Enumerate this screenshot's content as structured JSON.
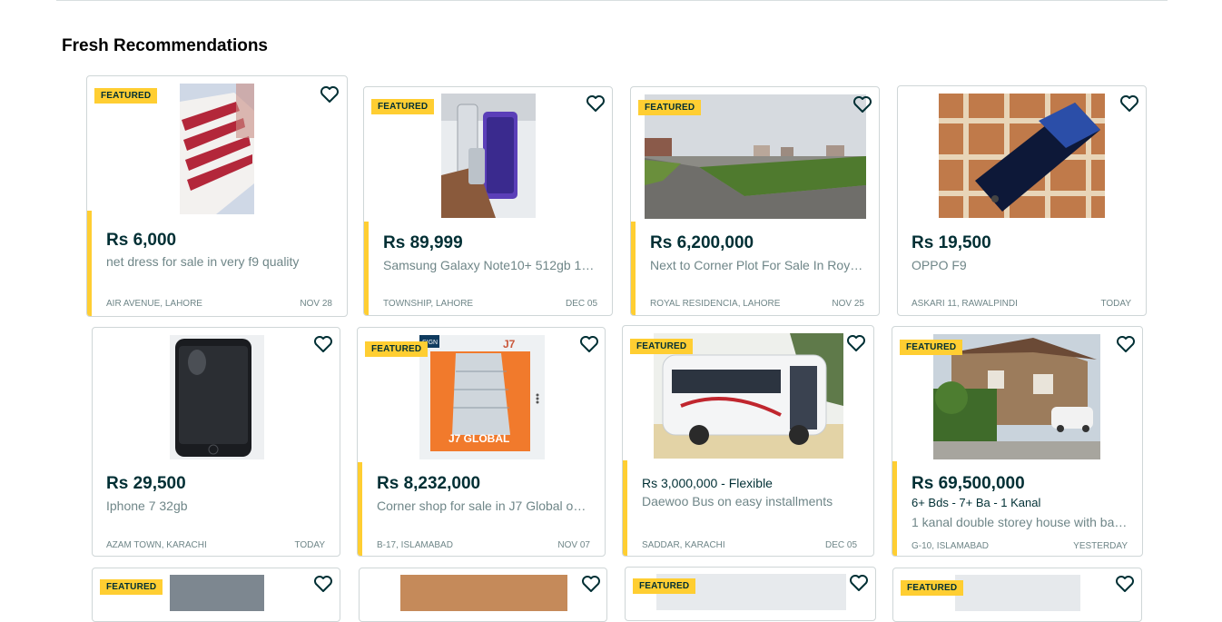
{
  "section": {
    "title": "Fresh Recommendations"
  },
  "badge_label": "FEATURED",
  "colors": {
    "accent": "#ffce32",
    "text": "#002f34",
    "muted": "#6f8688",
    "border": "#cfd6d7"
  },
  "listings": [
    {
      "price": "Rs 6,000",
      "title": "net dress for sale in very f9 quality",
      "location": "AIR AVENUE, LAHORE",
      "date": "NOV 28",
      "featured": true
    },
    {
      "price": "Rs 89,999",
      "title": "Samsung Galaxy Note10+ 512gb 128…",
      "location": "TOWNSHIP, LAHORE",
      "date": "DEC 05",
      "featured": true
    },
    {
      "price": "Rs 6,200,000",
      "title": "Next to Corner Plot For Sale In Royal …",
      "location": "ROYAL RESIDENCIA, LAHORE",
      "date": "NOV 25",
      "featured": true
    },
    {
      "price": "Rs 19,500",
      "title": "OPPO F9",
      "location": "ASKARI 11, RAWALPINDI",
      "date": "TODAY",
      "featured": false
    },
    {
      "price": "Rs 29,500",
      "title": "Iphone 7 32gb",
      "location": "AZAM TOWN, KARACHI",
      "date": "TODAY",
      "featured": false
    },
    {
      "price": "Rs 8,232,000",
      "title": "Corner shop for sale in J7 Global on i…",
      "location": "B-17, ISLAMABAD",
      "date": "NOV 07",
      "featured": true
    },
    {
      "price": "Rs 3,000,000 - Flexible",
      "title": "Daewoo Bus on easy installments",
      "location": "SADDAR, KARACHI",
      "date": "DEC 05",
      "featured": true
    },
    {
      "price": "Rs 69,500,000",
      "subtitle": "6+ Bds - 7+ Ba - 1 Kanal",
      "title": "1 kanal double storey house with bas…",
      "location": "G-10, ISLAMABAD",
      "date": "YESTERDAY",
      "featured": true
    }
  ],
  "images": {
    "j7_sign": "SIGN",
    "j7_logo": "J7",
    "j7_global": "J7 GLOBAL"
  }
}
